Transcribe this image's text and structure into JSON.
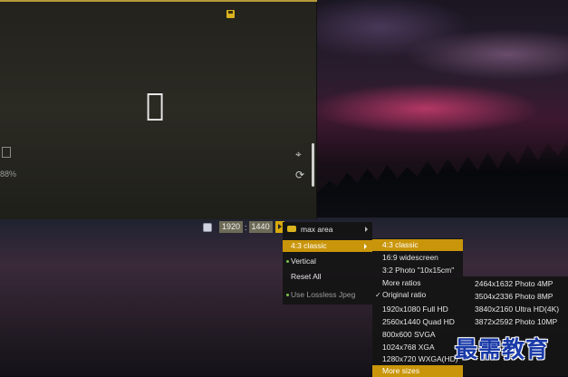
{
  "editor": {
    "zoom_text": "88%"
  },
  "sizebar": {
    "width": "1920",
    "separator": ":",
    "height": "1440"
  },
  "menu1": {
    "header": "max area",
    "items": [
      {
        "label": "4:3 classic",
        "selected": true,
        "submenu": true
      },
      {
        "label": "Vertical",
        "dot": true
      },
      {
        "label": "Reset All"
      },
      {
        "label": "Use Lossless Jpeg",
        "dot": true
      }
    ]
  },
  "menu2": {
    "items": [
      {
        "label": "4:3 classic",
        "selected": true
      },
      {
        "label": "16:9 widescreen"
      },
      {
        "label": "3:2 Photo \"10x15cm\""
      },
      {
        "label": "More ratios"
      },
      {
        "label": "Original ratio",
        "check": true
      },
      {
        "label": "1920x1080 Full HD"
      },
      {
        "label": "2560x1440 Quad HD"
      },
      {
        "label": "800x600 SVGA"
      },
      {
        "label": "1024x768 XGA"
      },
      {
        "label": "1280x720 WXGA(HD)"
      },
      {
        "label": "More sizes",
        "selected": true
      }
    ]
  },
  "menu3": {
    "items": [
      {
        "label": "2464x1632 Photo 4MP"
      },
      {
        "label": "3504x2336 Photo 8MP"
      },
      {
        "label": "3840x2160 Ultra HD(4K)"
      },
      {
        "label": "3872x2592 Photo 10MP"
      }
    ]
  },
  "watermark": "最需教育",
  "colors": {
    "accent": "#c9950a",
    "menu_bg": "#141414"
  }
}
